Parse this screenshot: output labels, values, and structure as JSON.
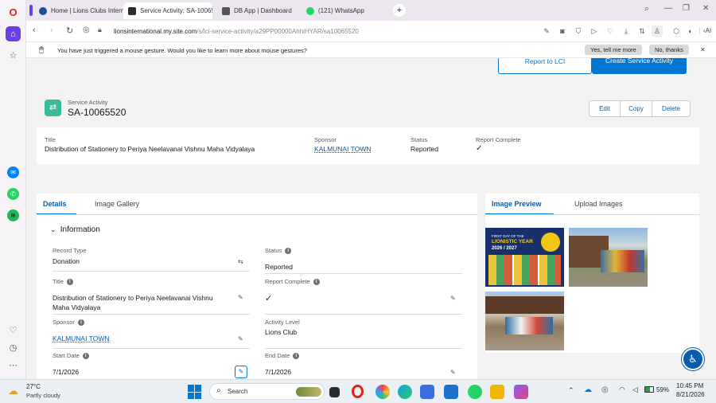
{
  "browser": {
    "tabs": [
      {
        "label": "Home | Lions Clubs Intern",
        "active": false,
        "color": "#1a4f9c"
      },
      {
        "label": "Service Activity: SA-10065",
        "active": true,
        "color": "#2a2a2a"
      },
      {
        "label": "DB App | Dashboard",
        "active": false,
        "color": "#555"
      },
      {
        "label": "(121) WhatsApp",
        "active": false,
        "color": "#25d366"
      }
    ],
    "url_domain": "lionsinternational.my.site.com",
    "url_path": "/s/lci-service-activity/a29PP00000AhhiHYAR/sa10065520",
    "ai_label": "AI",
    "gesture_msg": "You have just triggered a mouse gesture. Would you like to learn more about mouse gestures?",
    "gesture_yes": "Yes, tell me more",
    "gesture_no": "No, thanks"
  },
  "top_buttons": {
    "report": "Report to LCI",
    "create": "Create Service Activity"
  },
  "record": {
    "type_label": "Service Activity",
    "id": "SA-10065520",
    "actions": {
      "edit": "Edit",
      "copy": "Copy",
      "delete": "Delete"
    }
  },
  "highlights": {
    "title_label": "Title",
    "title_value": "Distribution of Stationery to Periya Neelavanai Vishnu Maha Vidyalaya",
    "sponsor_label": "Sponsor",
    "sponsor_value": "KALMUNAI TOWN",
    "status_label": "Status",
    "status_value": "Reported",
    "report_label": "Report Complete"
  },
  "detail_tabs": {
    "details": "Details",
    "gallery": "Image Gallery"
  },
  "section": {
    "title": "Information"
  },
  "fields": {
    "record_type_label": "Record Type",
    "record_type_value": "Donation",
    "status_label": "Status",
    "status_value": "Reported",
    "title_label": "Title",
    "title_value": "Distribution of Stationery to Periya Neelavanai Vishnu Maha Vidyalaya",
    "report_label": "Report Complete",
    "sponsor_label": "Sponsor",
    "sponsor_value": "KALMUNAI TOWN",
    "level_label": "Activity Level",
    "level_value": "Lions Club",
    "start_label": "Start Date",
    "start_value": "7/1/2026",
    "end_label": "End Date",
    "end_value": "7/1/2026"
  },
  "preview_tabs": {
    "preview": "Image Preview",
    "upload": "Upload Images"
  },
  "poster": {
    "line1": "FIRST DAY OF THE",
    "line2": "LIONISTIC YEAR",
    "line3": "2026 / 2027"
  },
  "taskbar": {
    "temp": "27°C",
    "weather": "Partly cloudy",
    "search": "Search",
    "battery": "59%",
    "time": "10:45 PM",
    "date": "8/21/2026"
  },
  "colors": {
    "brand": "#0176d3",
    "accent_teal": "#3bba9c",
    "opera": "#e2231a"
  }
}
